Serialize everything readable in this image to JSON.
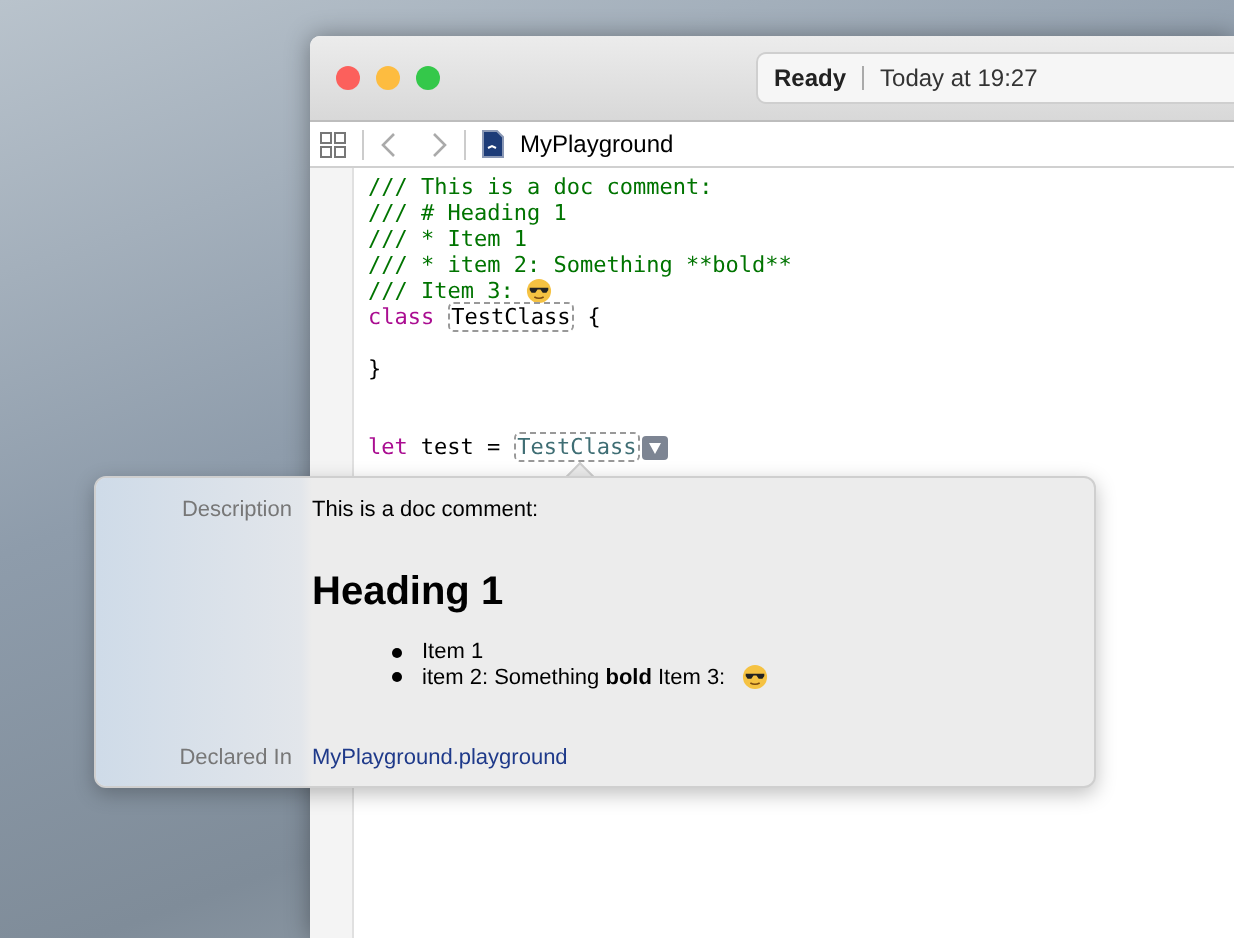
{
  "window": {
    "status": {
      "state": "Ready",
      "time": "Today at 19:27"
    }
  },
  "jump_bar": {
    "file": "MyPlayground"
  },
  "code_lines": [
    {
      "kind": "code",
      "tokens": [
        {
          "kind": "comment",
          "text": "/// This is a doc comment:"
        }
      ]
    },
    {
      "kind": "code",
      "tokens": [
        {
          "kind": "comment",
          "text": "/// # Heading 1"
        }
      ]
    },
    {
      "kind": "code",
      "tokens": [
        {
          "kind": "comment",
          "text": "/// * Item 1"
        }
      ]
    },
    {
      "kind": "code",
      "tokens": [
        {
          "kind": "comment",
          "text": "/// * item 2: Something **bold**"
        }
      ]
    },
    {
      "kind": "code",
      "tokens": [
        {
          "kind": "comment",
          "text": "/// Item 3:"
        },
        {
          "kind": "emoji"
        }
      ]
    },
    {
      "kind": "code",
      "tokens": [
        {
          "kind": "keyword",
          "text": "class"
        },
        {
          "kind": "symbol",
          "text": "TestClass"
        },
        {
          "kind": "plain",
          "text": "{"
        }
      ]
    },
    {
      "kind": "blank"
    },
    {
      "kind": "code",
      "tokens": [
        {
          "kind": "plain",
          "text": "}"
        }
      ]
    },
    {
      "kind": "blank"
    },
    {
      "kind": "blank"
    },
    {
      "kind": "code",
      "tokens": [
        {
          "kind": "keyword",
          "text": "let"
        },
        {
          "kind": "plain",
          "text": "test ="
        },
        {
          "kind": "symbol_ref",
          "text": "TestClass"
        },
        {
          "kind": "menu"
        }
      ]
    }
  ],
  "quick_help": {
    "description_label": "Description",
    "summary": "This is a doc comment:",
    "heading": "Heading 1",
    "bullets": [
      {
        "text": "Item 1",
        "emoji": false
      },
      {
        "text": "item 2: Something **bold** Item 3:",
        "emoji": true
      }
    ],
    "declared_label": "Declared In",
    "declared_in": "MyPlayground.playground"
  }
}
